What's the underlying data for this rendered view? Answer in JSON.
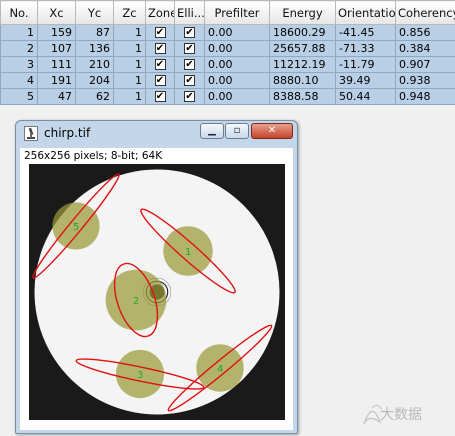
{
  "table": {
    "headers": [
      "No.",
      "Xc",
      "Yc",
      "Zc",
      "Zone",
      "Elli...",
      "Prefilter",
      "Energy",
      "Orientation",
      "Coherency"
    ],
    "rows": [
      {
        "no": "1",
        "xc": "159",
        "yc": "87",
        "zc": "1",
        "zone": true,
        "ellipse": true,
        "prefilter": "0.00",
        "energy": "18600.29",
        "orientation": "-41.45",
        "coherency": "0.856"
      },
      {
        "no": "2",
        "xc": "107",
        "yc": "136",
        "zc": "1",
        "zone": true,
        "ellipse": true,
        "prefilter": "0.00",
        "energy": "25657.88",
        "orientation": "-71.33",
        "coherency": "0.384"
      },
      {
        "no": "3",
        "xc": "111",
        "yc": "210",
        "zc": "1",
        "zone": true,
        "ellipse": true,
        "prefilter": "0.00",
        "energy": "11212.19",
        "orientation": "-11.79",
        "coherency": "0.907"
      },
      {
        "no": "4",
        "xc": "191",
        "yc": "204",
        "zc": "1",
        "zone": true,
        "ellipse": true,
        "prefilter": "0.00",
        "energy": "8880.10",
        "orientation": "39.49",
        "coherency": "0.938"
      },
      {
        "no": "5",
        "xc": "47",
        "yc": "62",
        "zc": "1",
        "zone": true,
        "ellipse": true,
        "prefilter": "0.00",
        "energy": "8388.58",
        "orientation": "50.44",
        "coherency": "0.948"
      }
    ],
    "check_glyph": "✔"
  },
  "window": {
    "title": "chirp.tif",
    "info": "256x256 pixels; 8-bit; 64K",
    "min_glyph": "▁",
    "max_glyph": "▫",
    "close_glyph": "✕",
    "icon": "imagej-microscope-icon"
  },
  "overlay": {
    "zone_color": "#9a9a3a",
    "ellipse_color": "#e01010",
    "label_color": "#22aa22"
  },
  "watermark": {
    "text": "大数据"
  }
}
